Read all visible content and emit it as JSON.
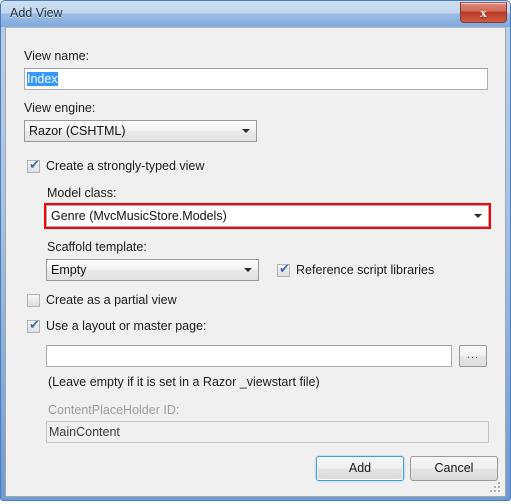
{
  "window": {
    "title": "Add View",
    "close_glyph": "x"
  },
  "form": {
    "view_name_label": "View name:",
    "view_name_value": "Index",
    "view_engine_label": "View engine:",
    "view_engine_value": "Razor (CSHTML)",
    "strongly_typed_label": "Create a strongly-typed view",
    "strongly_typed_checked": true,
    "model_class_label": "Model class:",
    "model_class_value": "Genre (MvcMusicStore.Models)",
    "model_class_highlight_color": "#ff0000",
    "scaffold_label": "Scaffold template:",
    "scaffold_value": "Empty",
    "reference_scripts_label": "Reference script libraries",
    "reference_scripts_checked": true,
    "partial_view_label": "Create as a partial view",
    "partial_view_checked": false,
    "layout_label": "Use a layout or master page:",
    "layout_checked": true,
    "layout_value": "",
    "layout_placeholder": "",
    "browse_label": "...",
    "layout_hint": "(Leave empty if it is set in a Razor _viewstart file)",
    "contentplaceholder_label": "ContentPlaceHolder ID:",
    "contentplaceholder_value": "MainContent"
  },
  "buttons": {
    "add_label": "Add",
    "cancel_label": "Cancel"
  },
  "checkmark_glyph": "✔"
}
